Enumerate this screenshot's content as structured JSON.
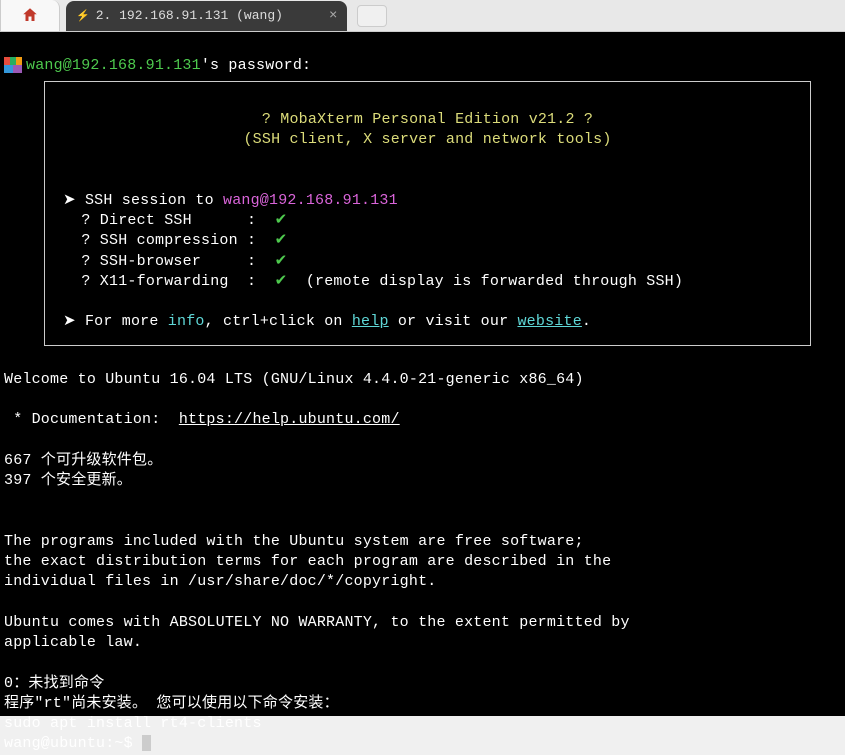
{
  "tabs": {
    "active_title": "2. 192.168.91.131 (wang)"
  },
  "terminal": {
    "prompt_user": "wang@192.168.91.131",
    "prompt_suffix": "'s password:",
    "banner_title": "? MobaXterm Personal Edition v21.2 ?",
    "banner_subtitle": "(SSH client, X server and network tools)",
    "ssh_session_label": "➤ SSH session to ",
    "ssh_session_target": "wang@192.168.91.131",
    "feat_direct_ssh_label": "  ? Direct SSH      :  ",
    "feat_compression_label": "  ? SSH compression :  ",
    "feat_browser_label": "  ? SSH-browser     :  ",
    "feat_x11_label": "  ? X11-forwarding  :  ",
    "x11_note": "  (remote display is forwarded through SSH)",
    "more_prefix": "➤ For more ",
    "more_info": "info",
    "more_mid1": ", ctrl+click on ",
    "more_help": "help",
    "more_mid2": " or visit our ",
    "more_website": "website",
    "more_end": ".",
    "welcome": "Welcome to Ubuntu 16.04 LTS (GNU/Linux 4.4.0-21-generic x86_64)",
    "doc_label": " * Documentation:  ",
    "doc_url": "https://help.ubuntu.com/",
    "upgrades": "667 个可升级软件包。",
    "security_updates": "397 个安全更新。",
    "freesoft1": "The programs included with the Ubuntu system are free software;",
    "freesoft2": "the exact distribution terms for each program are described in the",
    "freesoft3": "individual files in /usr/share/doc/*/copyright.",
    "warranty1": "Ubuntu comes with ABSOLUTELY NO WARRANTY, to the extent permitted by",
    "warranty2": "applicable law.",
    "err_cmd": "0：未找到命令",
    "rt_suggest": "程序\"rt\"尚未安装。 您可以使用以下命令安装：",
    "rt_install": "sudo apt install rt4-clients",
    "shell_prompt": "wang@ubuntu:~$ "
  }
}
